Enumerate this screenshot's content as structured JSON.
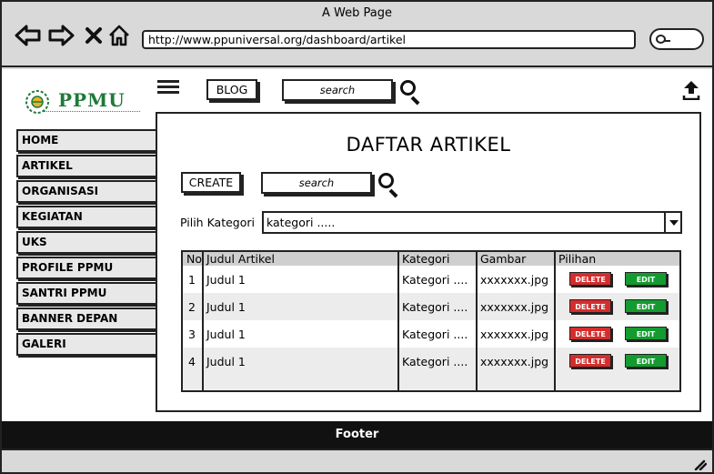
{
  "browser": {
    "title": "A Web Page",
    "url": "http://www.ppuniversal.org/dashboard/artikel"
  },
  "logo": {
    "text": "PPMU"
  },
  "sidebar": {
    "items": [
      {
        "label": "HOME"
      },
      {
        "label": "ARTIKEL"
      },
      {
        "label": "ORGANISASI"
      },
      {
        "label": "KEGIATAN"
      },
      {
        "label": "UKS"
      },
      {
        "label": "PROFILE PPMU"
      },
      {
        "label": "SANTRI PPMU"
      },
      {
        "label": "BANNER DEPAN"
      },
      {
        "label": "GALERI"
      }
    ]
  },
  "topbar": {
    "blog_label": "BLOG",
    "search_placeholder": "search"
  },
  "main": {
    "title": "DAFTAR ARTIKEL",
    "create_label": "CREATE",
    "search_placeholder": "search",
    "category_label": "Pilih Kategori",
    "category_value": "kategori ....."
  },
  "table": {
    "headers": [
      "No",
      "Judul Artikel",
      "Kategori",
      "Gambar",
      "Pilihan"
    ],
    "rows": [
      {
        "no": "1",
        "judul": "Judul 1",
        "kategori": "Kategori ....",
        "gambar": "xxxxxxx.jpg"
      },
      {
        "no": "2",
        "judul": "Judul 1",
        "kategori": "Kategori ....",
        "gambar": "xxxxxxx.jpg"
      },
      {
        "no": "3",
        "judul": "Judul 1",
        "kategori": "Kategori ....",
        "gambar": "xxxxxxx.jpg"
      },
      {
        "no": "4",
        "judul": "Judul 1",
        "kategori": "Kategori ....",
        "gambar": "xxxxxxx.jpg"
      }
    ],
    "delete_label": "DELETE",
    "edit_label": "EDIT"
  },
  "footer": {
    "text": "Footer"
  },
  "colors": {
    "delete": "#d42d2d",
    "edit": "#139b2f",
    "logo": "#1e7a3a"
  }
}
